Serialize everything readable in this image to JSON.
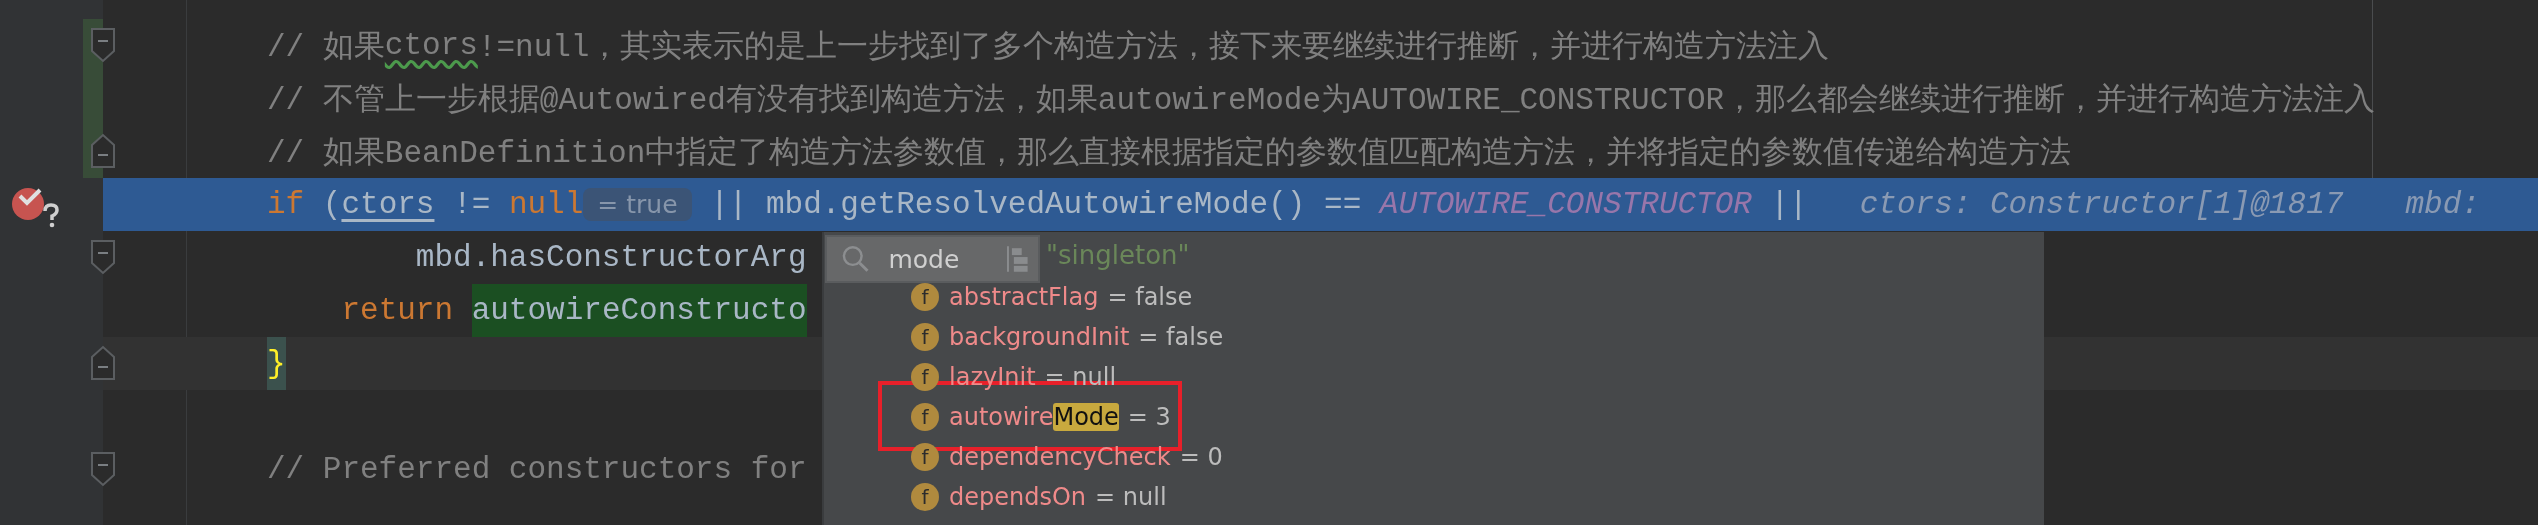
{
  "editor": {
    "lines": [
      {
        "changed": true,
        "fold_start": true,
        "fold_end": false,
        "breakpoint": false,
        "highlighted": false,
        "current": false,
        "tokens": [
          {
            "kind": "comment",
            "text": "// 如果"
          },
          {
            "kind": "typo",
            "text": "ctors"
          },
          {
            "kind": "comment",
            "text": "!=null，其实表示的是上一步找到了多个构造方法，接下来要继续进行推断，并进行构造方法注入"
          }
        ]
      },
      {
        "changed": true,
        "fold_start": false,
        "fold_end": false,
        "breakpoint": false,
        "highlighted": false,
        "current": false,
        "tokens": [
          {
            "kind": "comment",
            "text": "// 不管上一步根据@Autowired有没有找到构造方法，如果autowireMode为AUTOWIRE_CONSTRUCTOR，那么都会继续进行推断，并进行构造方法注入"
          }
        ]
      },
      {
        "changed": true,
        "fold_start": false,
        "fold_end": true,
        "breakpoint": false,
        "highlighted": false,
        "current": false,
        "tokens": [
          {
            "kind": "comment",
            "text": "// 如果BeanDefinition中指定了构造方法参数值，那么直接根据指定的参数值匹配构造方法，并将指定的参数值传递给构造方法"
          }
        ]
      },
      {
        "changed": false,
        "fold_start": false,
        "fold_end": false,
        "breakpoint": true,
        "highlighted": true,
        "current": false,
        "tokens": [
          {
            "kind": "keyword",
            "text": "if"
          },
          {
            "kind": "plain",
            "text": " ("
          },
          {
            "kind": "variable",
            "text": "ctors"
          },
          {
            "kind": "plain",
            "text": " != "
          },
          {
            "kind": "keyword",
            "text": "null"
          },
          {
            "kind": "hint",
            "text": "= true"
          },
          {
            "kind": "plain",
            "text": " || mbd.getResolvedAutowireMode() == "
          },
          {
            "kind": "constant",
            "text": "AUTOWIRE_CONSTRUCTOR"
          },
          {
            "kind": "plain",
            "text": " ||"
          },
          {
            "kind": "inlay",
            "text": "ctors: Constructor[1]@1817"
          },
          {
            "kind": "inlay",
            "text": "mbd:"
          }
        ]
      },
      {
        "changed": false,
        "fold_start": true,
        "fold_end": false,
        "breakpoint": false,
        "highlighted": false,
        "current": false,
        "tokens": [
          {
            "kind": "plain",
            "text": "        mbd.hasConstructorArg"
          }
        ]
      },
      {
        "changed": false,
        "fold_start": false,
        "fold_end": false,
        "breakpoint": false,
        "highlighted": false,
        "current": false,
        "tokens": [
          {
            "kind": "keyword",
            "text": "    return"
          },
          {
            "kind": "step",
            "text": " autowireConstructo"
          }
        ]
      },
      {
        "changed": false,
        "fold_start": false,
        "fold_end": true,
        "breakpoint": false,
        "highlighted": false,
        "current": true,
        "tokens": [
          {
            "kind": "brace",
            "text": "}"
          }
        ]
      },
      {
        "changed": false,
        "fold_start": false,
        "fold_end": false,
        "breakpoint": false,
        "highlighted": false,
        "current": false
      },
      {
        "changed": false,
        "fold_start": true,
        "fold_end": false,
        "breakpoint": false,
        "highlighted": false,
        "current": false,
        "tokens": [
          {
            "kind": "comment",
            "text": "// Preferred constructors for"
          }
        ]
      }
    ]
  },
  "popup": {
    "search": {
      "value": "mode"
    },
    "top_value": "\"singleton\"",
    "fields": [
      {
        "type_letter": "f",
        "name": "abstractFlag",
        "value": "= false",
        "framed": false
      },
      {
        "type_letter": "f",
        "name": "backgroundInit",
        "value": "= false",
        "framed": false
      },
      {
        "type_letter": "f",
        "name": "lazyInit",
        "value": "= null",
        "framed": false
      },
      {
        "type_letter": "f",
        "name": "autowire",
        "match": "Mode",
        "value": "= 3",
        "framed": true
      },
      {
        "type_letter": "f",
        "name": "dependencyCheck",
        "value": "= 0",
        "framed": false
      },
      {
        "type_letter": "f",
        "name": "dependsOn",
        "value": "= null",
        "framed": false
      }
    ]
  }
}
